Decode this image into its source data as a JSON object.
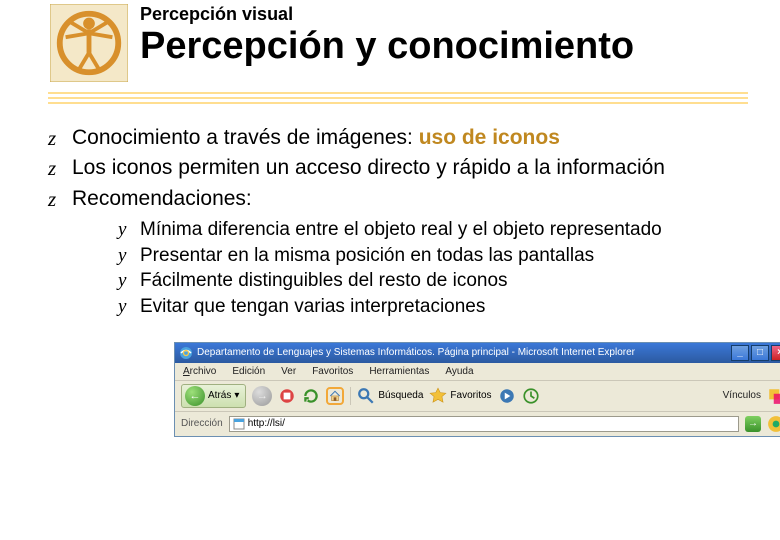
{
  "header": {
    "subtitle": "Percepción visual",
    "title": "Percepción y conocimiento"
  },
  "bullets": {
    "b1_pre": "Conocimiento a través de imágenes: ",
    "b1_hl": "uso de iconos",
    "b2": "Los iconos permiten un acceso directo y rápido a la información",
    "b3": "Recomendaciones:"
  },
  "sub": {
    "s1": "Mínima diferencia entre el objeto real y el objeto representado",
    "s2": "Presentar en la misma posición en todas las pantallas",
    "s3": "Fácilmente distinguibles del resto de iconos",
    "s4": "Evitar que tengan varias interpretaciones"
  },
  "browser": {
    "title": "Departamento de Lenguajes y Sistemas Informáticos. Página principal - Microsoft Internet Explorer",
    "menu": {
      "archivo": "Archivo",
      "edicion": "Edición",
      "ver": "Ver",
      "favoritos": "Favoritos",
      "herramientas": "Herramientas",
      "ayuda": "Ayuda"
    },
    "back": "Atrás",
    "search": "Búsqueda",
    "favoritos": "Favoritos",
    "vinculos": "Vínculos",
    "addr_label": "Dirección",
    "url": "http://lsi/"
  }
}
